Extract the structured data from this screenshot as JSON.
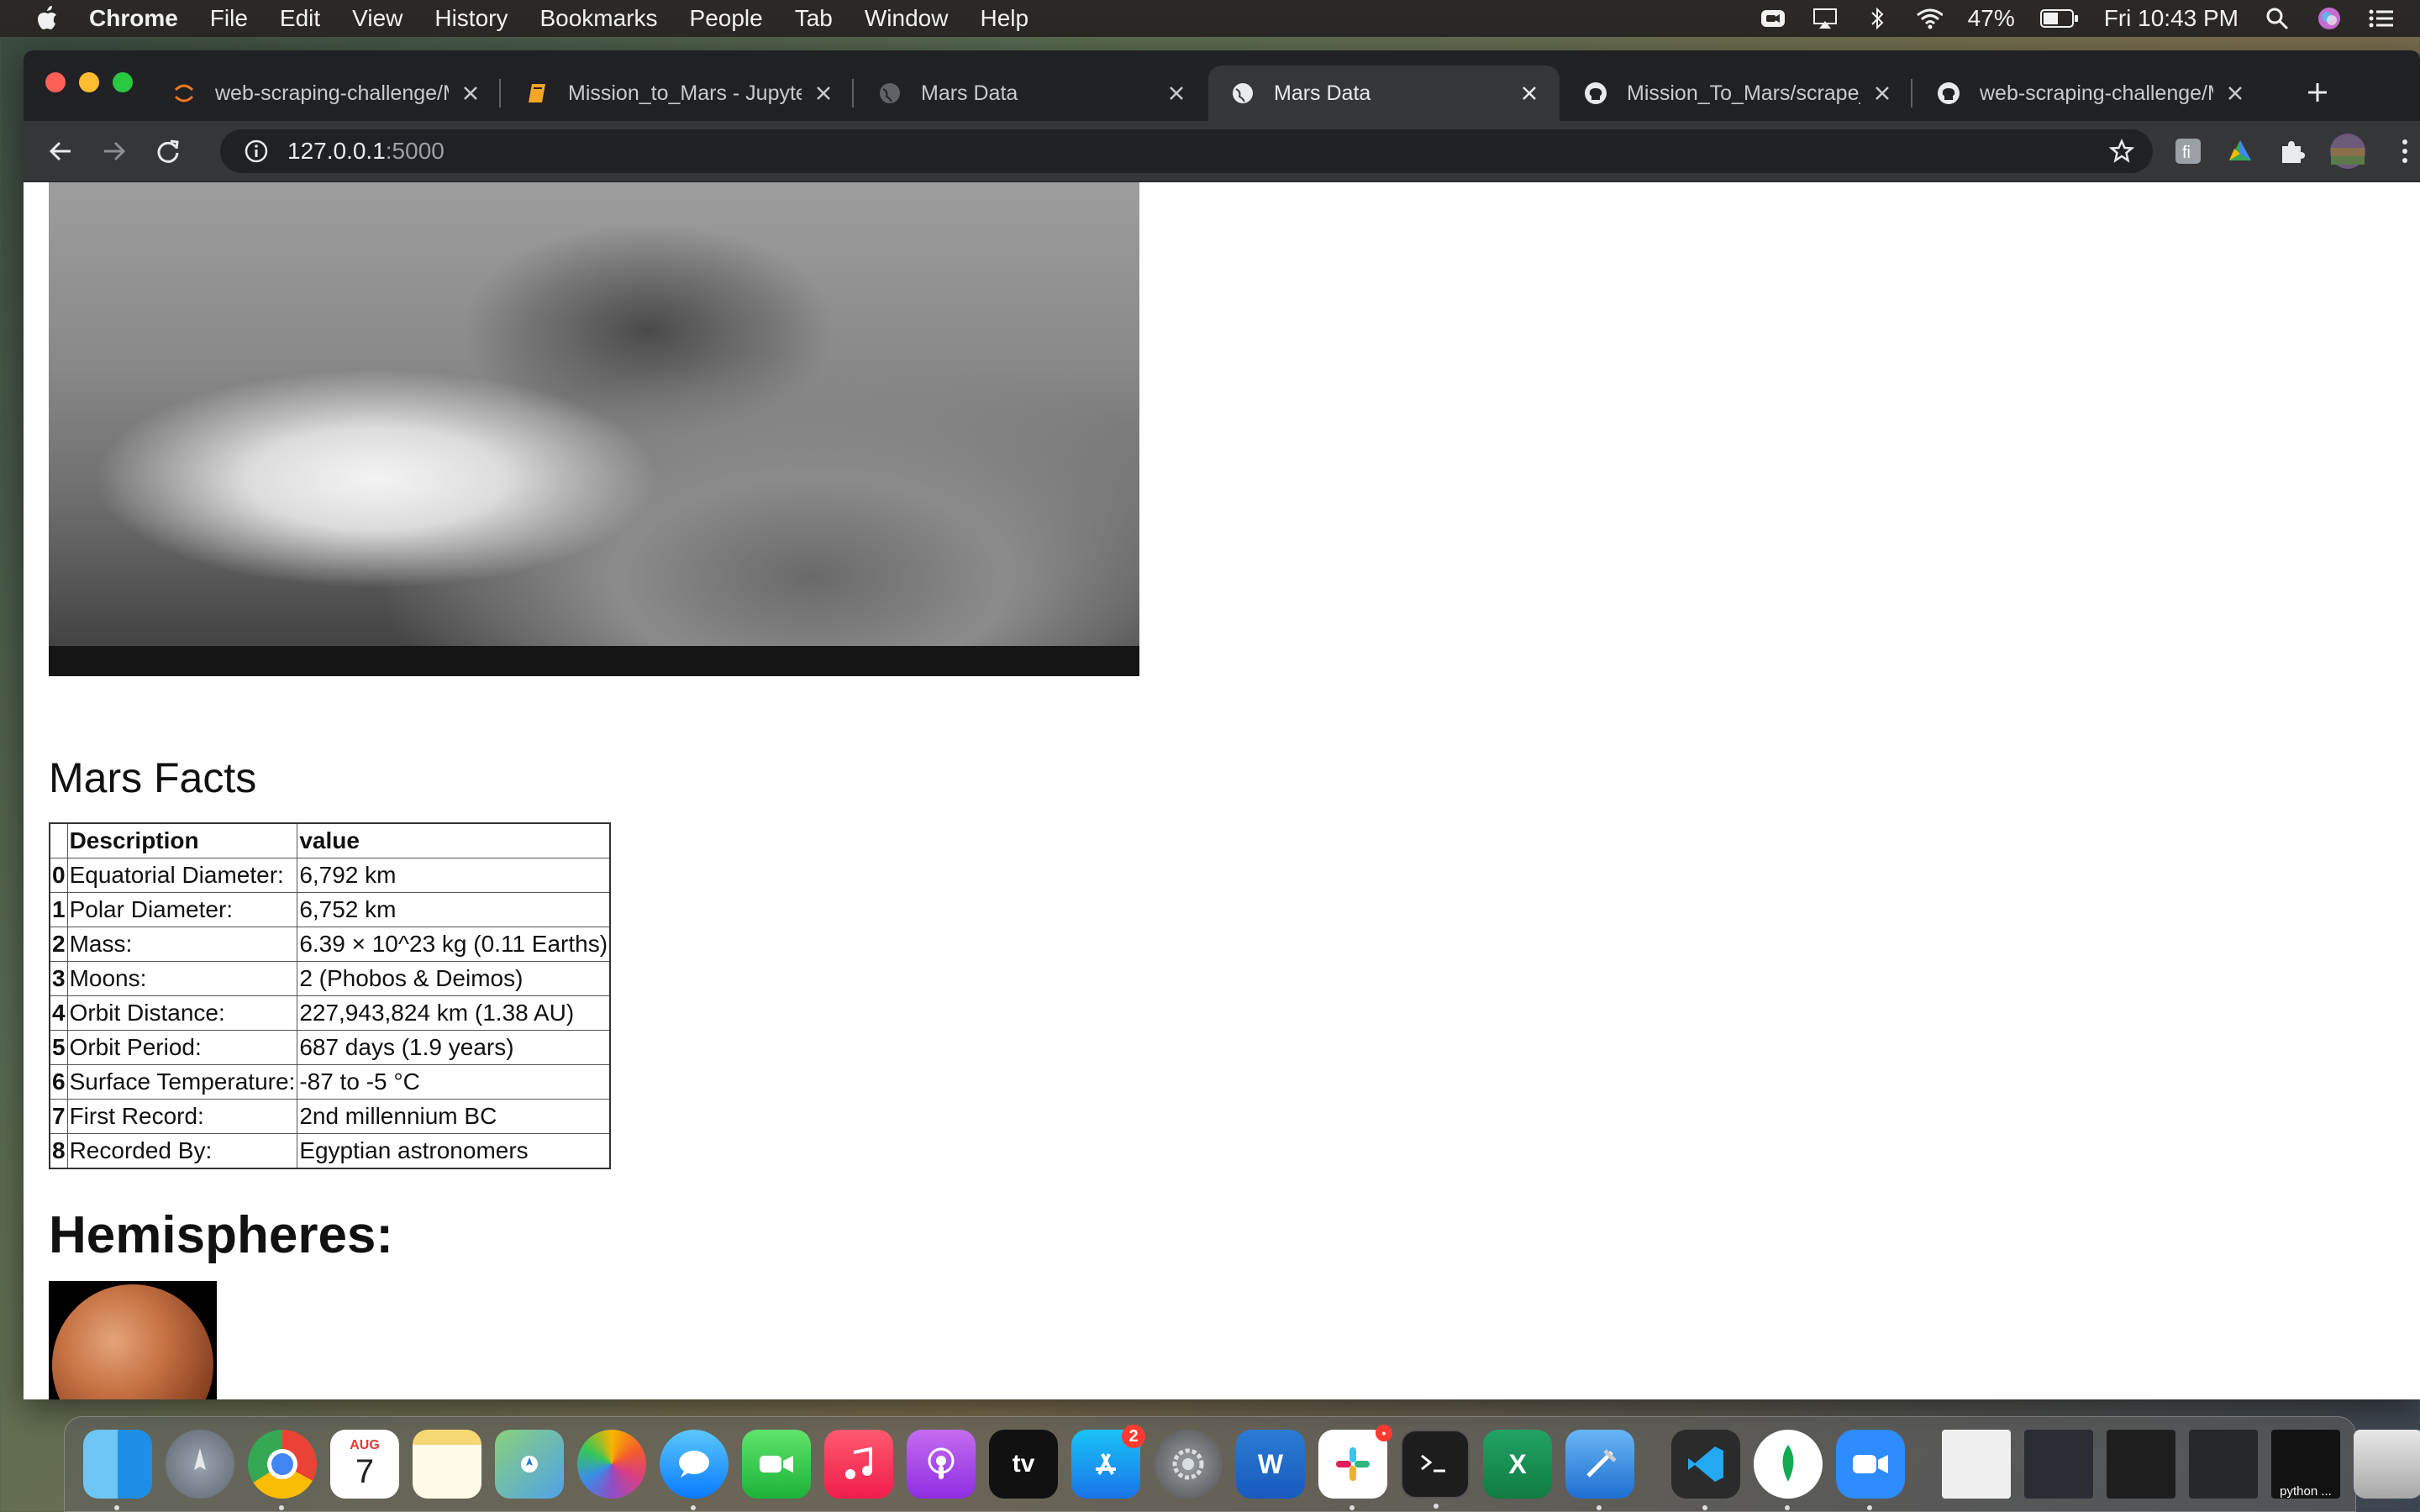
{
  "menubar": {
    "app_name": "Chrome",
    "menus": [
      "File",
      "Edit",
      "View",
      "History",
      "Bookmarks",
      "People",
      "Tab",
      "Window",
      "Help"
    ],
    "battery": "47%",
    "clock": "Fri 10:43 PM"
  },
  "tabs": [
    {
      "title": "web-scraping-challenge/M",
      "icon": "jupyter-icon",
      "active": false
    },
    {
      "title": "Mission_to_Mars - Jupyter",
      "icon": "notebook-icon",
      "active": false
    },
    {
      "title": "Mars Data",
      "icon": "globe-icon",
      "active": false
    },
    {
      "title": "Mars Data",
      "icon": "globe-icon",
      "active": true
    },
    {
      "title": "Mission_To_Mars/scrape_m",
      "icon": "github-icon",
      "active": false
    },
    {
      "title": "web-scraping-challenge/M",
      "icon": "github-icon",
      "active": false
    }
  ],
  "address": {
    "host": "127.0.0.1",
    "port": ":5000"
  },
  "page": {
    "facts_heading": "Mars Facts",
    "table": {
      "headers": [
        "Description",
        "value"
      ],
      "rows": [
        {
          "idx": "0",
          "desc": "Equatorial Diameter:",
          "value": "6,792 km"
        },
        {
          "idx": "1",
          "desc": "Polar Diameter:",
          "value": "6,752 km"
        },
        {
          "idx": "2",
          "desc": "Mass:",
          "value": "6.39 × 10^23 kg (0.11 Earths)"
        },
        {
          "idx": "3",
          "desc": "Moons:",
          "value": "2 (Phobos & Deimos)"
        },
        {
          "idx": "4",
          "desc": "Orbit Distance:",
          "value": "227,943,824 km (1.38 AU)"
        },
        {
          "idx": "5",
          "desc": "Orbit Period:",
          "value": "687 days (1.9 years)"
        },
        {
          "idx": "6",
          "desc": "Surface Temperature:",
          "value": "-87 to -5 °C"
        },
        {
          "idx": "7",
          "desc": "First Record:",
          "value": "2nd millennium BC"
        },
        {
          "idx": "8",
          "desc": "Recorded By:",
          "value": "Egyptian astronomers"
        }
      ]
    },
    "hemispheres_heading": "Hemispheres:"
  },
  "dock": {
    "calendar_month": "AUG",
    "calendar_day": "7",
    "appstore_badge": "2",
    "appletv_label": "tv",
    "word_label": "W",
    "excel_label": "X",
    "python_label": "python ..."
  },
  "colors": {
    "active_tab": "#35363a",
    "tabstrip": "#202124",
    "menubar": "#2b2926"
  }
}
